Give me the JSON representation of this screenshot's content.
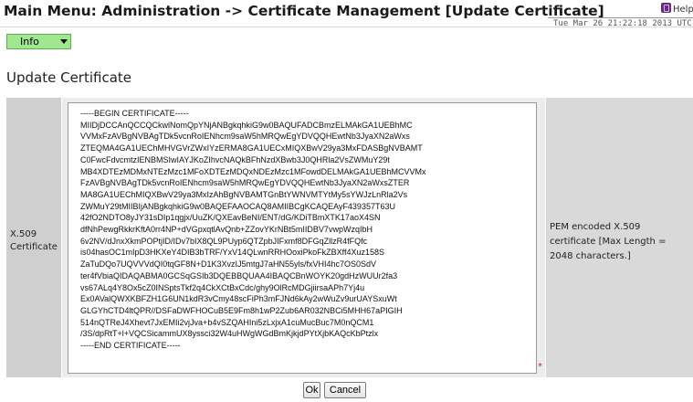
{
  "header": {
    "title": "Main Menu: Administration -> Certificate Management [Update Certificate]",
    "datetime": "Tue Mar 26 21:22:18 2013 UTC",
    "help_label": "Help"
  },
  "info_menu": {
    "label": "Info"
  },
  "page": {
    "heading": "Update Certificate"
  },
  "form": {
    "field_label": "X.509 Certificate",
    "field_help": "PEM encoded X.509 certificate [Max Length = 2048 characters.]",
    "required_marker": "*",
    "certificate_value": "-----BEGIN CERTIFICATE-----\nMIIDjDCCAnQCCQCkwlNomQpYNjANBgkqhkiG9w0BAQUFADCBmzELMAkGA1UEBhMC\nVVMxFzAVBgNVBAgTDk5vcnRoIENhcm9saW5hMRQwEgYDVQQHEwtNb3JyaXN2aWxs\nZTEQMA4GA1UEChMHVGVrZWxIYzERMA8GA1UECxMIQXBwV29ya3MxFDASBgNVBAMT\nC0FwcFdvcmtzIENBMSIwIAYJKoZIhvcNAQkBFhNzdXBwb3J0QHRla2VsZWMuY29t\nMB4XDTEzMDMxNTEzMzc1MFoXDTEzMDQxNDEzMzc1MFowdDELMAkGA1UEBhMCVVMx\nFzAVBgNVBAgTDk5vcnRoIENhcm9saW5hMRQwEgYDVQQHEwtNb3JyaXN2aWxsZTER\nMA8GA1UEChMIQXBwV29ya3MxIzAhBgNVBAMTGnBtYWNVMTYtMy5sYWJzLnRla2Vs\nZWMuY29tMIIBIjANBgkqhkiG9w0BAQEFAAOCAQ8AMIIBCgKCAQEAyF439357T63U\n42fO2NDTO8yJY31sDIp1qgjx/UuZK/QXEavBeNI/ENT/dG/KDiTBmXTK17aoX4SN\ndfNhPewgRkkrKftA0rr4NP+dVGpxqtlAvQnb+ZZovYKrNBt5mIIDBV7vwpWzqIbH\n6v2NV/dJnxXkmPOPtjID/IDv7bIX8QL9PUyp6QTZpbJIFxmf8DFGqZllzR4fFQfc\nis04hasOC1mIpD3HKXeY4DIB3bTRF/YxV14QLwnRRHOoxiPkoFkZBXff4Xuz158S\nZaTuDQo7UQVVVdQI0tqGF8N+D1K3XvzIJ5mtgJ7aHN55yls/fxVHI4hc7OS0SdV\nter4fVbiaQIDAQABMA0GCSqGSIb3DQEBBQUAA4IBAQCBnWOYK20gdHzWUUr2fa3\nvs67ALq4Y8Ox5cZ0INSptsTkf2q4CkXCtBxCdc/ghy9OlRcMDGjiirsaAPh7Yj4u\nEx0AValQWXKBFZH1G6UN1kdR3vCmy48scFiPh3mFJNd6kAy2wWuZv9urUAYSxuWt\nGLGYhCTD4ltQPR//DSFaDWFHOCuB5E9Fm8h1wP2Zub6AR032NBCi5MHH67aPIGIH\n514nQTReJ4Xhevt7JxEMIi2vjJva+b4vSZQAHIni5zLxjxA1cuMucBuc7M0nQCM1\n/3S/dpRtT+l+VQCSicammUX8yssci32W4uHWgWGdBmKjkjdPYtXjbKAQcKbPtzlx\n-----END CERTIFICATE-----"
  },
  "buttons": {
    "ok_label": "Ok",
    "cancel_label": "Cancel"
  },
  "colors": {
    "info_bg": "#9fe88f",
    "label_cell_bg": "#cfcfcf",
    "value_cell_bg": "#ececec",
    "help_cell_bg": "#d9d9d9",
    "required_marker": "#e02020"
  }
}
